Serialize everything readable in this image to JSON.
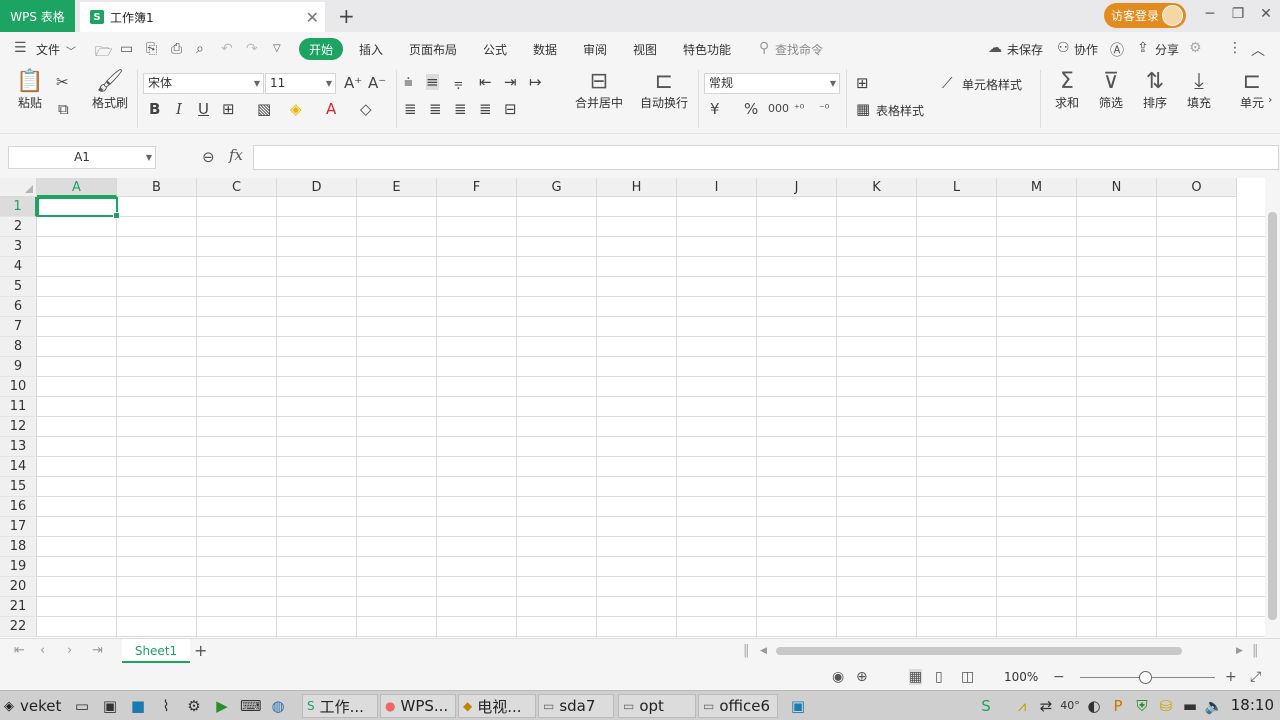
{
  "titlebar": {
    "app_badge": "WPS 表格",
    "doc_tab": "工作簿1",
    "tab_close": "✕",
    "new_tab": "+",
    "login": "访客登录",
    "win_min": "─",
    "win_restore": "❐",
    "win_close": "✕"
  },
  "menu": {
    "file": "文件",
    "tabs": [
      "开始",
      "插入",
      "页面布局",
      "公式",
      "数据",
      "审阅",
      "视图",
      "特色功能"
    ],
    "search": "查找命令",
    "unsaved": "未保存",
    "collab": "协作",
    "share": "分享"
  },
  "ribbon": {
    "paste": "粘贴",
    "format_painter": "格式刷",
    "font_name": "宋体",
    "font_size": "11",
    "merge_center": "合并居中",
    "wrap_text": "自动换行",
    "number_format": "常规",
    "cell_style": "单元格样式",
    "table_style": "表格样式",
    "sum": "求和",
    "filter": "筛选",
    "sort": "排序",
    "fill": "填充",
    "cell": "单元"
  },
  "formula_bar": {
    "name_box": "A1",
    "fx": "fx",
    "value": ""
  },
  "grid": {
    "columns": [
      "A",
      "B",
      "C",
      "D",
      "E",
      "F",
      "G",
      "H",
      "I",
      "J",
      "K",
      "L",
      "M",
      "N",
      "O"
    ],
    "rows": [
      "1",
      "2",
      "3",
      "4",
      "5",
      "6",
      "7",
      "8",
      "9",
      "10",
      "11",
      "12",
      "13",
      "14",
      "15",
      "16",
      "17",
      "18",
      "19",
      "20",
      "21",
      "22"
    ],
    "active_column": "A",
    "active_row": "1"
  },
  "sheets": {
    "tabs": [
      "Sheet1"
    ],
    "add": "+"
  },
  "status": {
    "zoom": "100%"
  },
  "taskbar": {
    "start": "veket",
    "windows": [
      "工作...",
      "WPS...",
      "电视...",
      "sda7",
      "opt",
      "office6"
    ],
    "clock": "18:10"
  },
  "colors": {
    "accent": "#1da362",
    "login": "#e38b1f"
  }
}
